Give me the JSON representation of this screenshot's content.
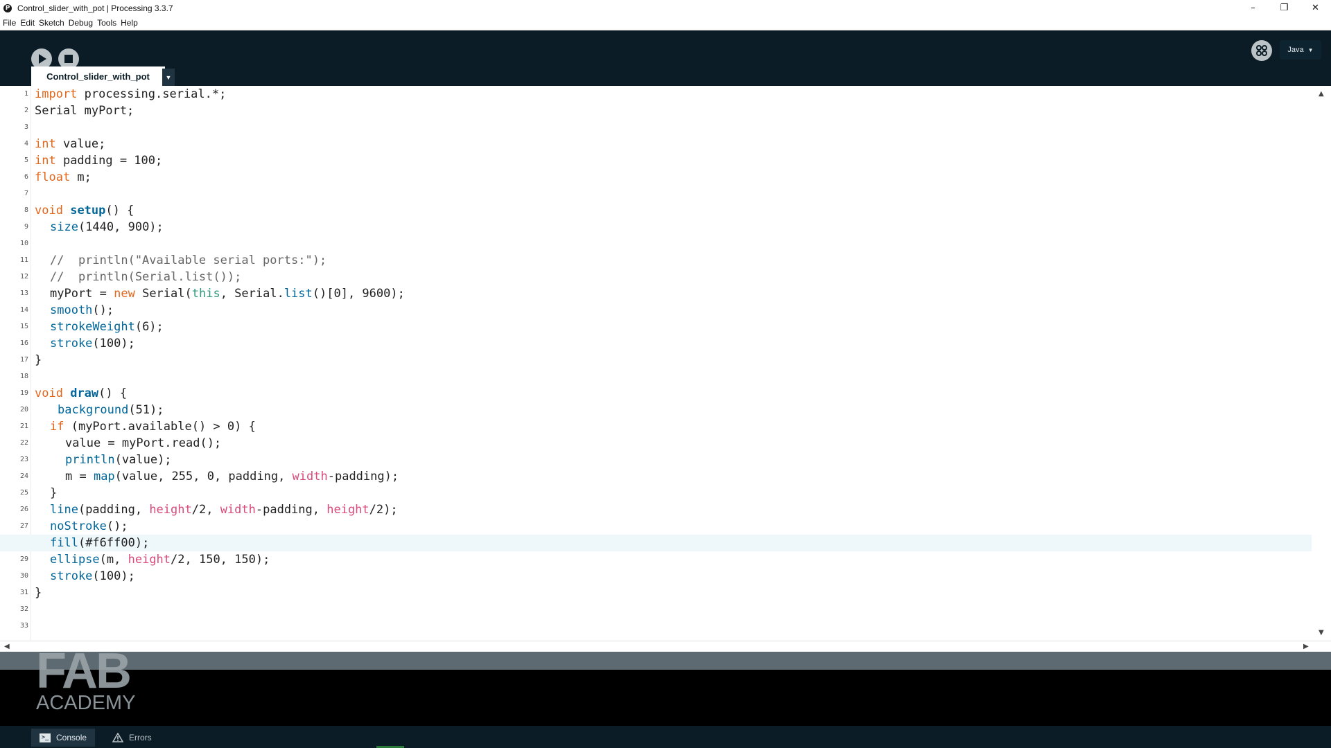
{
  "window": {
    "title": "Control_slider_with_pot | Processing 3.3.7",
    "icon": "processing-icon",
    "controls": [
      "–",
      "❐",
      "✕"
    ]
  },
  "menu": [
    "File",
    "Edit",
    "Sketch",
    "Debug",
    "Tools",
    "Help"
  ],
  "toolbar": {
    "run_icon": "play-icon",
    "stop_icon": "stop-icon",
    "debug_icon": "debugger-icon",
    "mode_label": "Java",
    "mode_caret": "▼"
  },
  "tab": {
    "name": "Control_slider_with_pot",
    "menu_caret": "▼"
  },
  "editor": {
    "current_line": 28,
    "line_numbers": [
      "1",
      "2",
      "3",
      "4",
      "5",
      "6",
      "7",
      "8",
      "9",
      "10",
      "11",
      "12",
      "13",
      "14",
      "15",
      "16",
      "17",
      "18",
      "19",
      "20",
      "21",
      "22",
      "23",
      "24",
      "25",
      "26",
      "27",
      "28",
      "29",
      "30",
      "31",
      "32",
      "33"
    ],
    "code": {
      "l1": {
        "kw": "import",
        "rest": " processing.serial.*;"
      },
      "l2": "Serial myPort;",
      "l4": {
        "kw": "int",
        "rest": " value;"
      },
      "l5": {
        "kw": "int",
        "rest": " padding = 100;"
      },
      "l6": {
        "kw": "float",
        "rest": " m;"
      },
      "l8": {
        "kw": "void",
        "fn": "setup",
        "rest": "() {"
      },
      "l9": {
        "fn": "size",
        "rest": "(1440, 900);"
      },
      "l11": "//  println(\"Available serial ports:\");",
      "l12": "//  println(Serial.list());",
      "l13": {
        "a": "myPort = ",
        "kw": "new",
        "b": " Serial(",
        "th": "this",
        "c": ", Serial.",
        "fn": "list",
        "d": "()[0], 9600);"
      },
      "l14": {
        "fn": "smooth",
        "rest": "();"
      },
      "l15": {
        "fn": "strokeWeight",
        "rest": "(6);"
      },
      "l16": {
        "fn": "stroke",
        "rest": "(100);"
      },
      "l17": "}",
      "l19": {
        "kw": "void",
        "fn": "draw",
        "rest": "() {"
      },
      "l20": {
        "fn": "background",
        "rest": "(51);"
      },
      "l21": {
        "kw": "if",
        "rest": " (myPort.available() > 0) {"
      },
      "l22": "value = myPort.read();",
      "l23": {
        "fn": "println",
        "rest": "(value);"
      },
      "l24": {
        "a": "m = ",
        "fn": "map",
        "b": "(value, 255, 0, padding, ",
        "var": "width",
        "c": "-padding);"
      },
      "l25": "}",
      "l26": {
        "fn": "line",
        "a": "(padding, ",
        "v1": "height",
        "b": "/2, ",
        "v2": "width",
        "c": "-padding, ",
        "v3": "height",
        "d": "/2);"
      },
      "l27": {
        "fn": "noStroke",
        "rest": "();"
      },
      "l28": {
        "fn": "fill",
        "rest": "(#f6ff00);"
      },
      "l29": {
        "fn": "ellipse",
        "a": "(m, ",
        "var": "height",
        "b": "/2, 150, 150);"
      },
      "l30": {
        "fn": "stroke",
        "rest": "(100);"
      },
      "l31": "}"
    }
  },
  "scroll": {
    "up": "▲",
    "down": "▼",
    "left": "◀",
    "right": "▶"
  },
  "logo": {
    "line1": "FAB",
    "line2": "ACADEMY"
  },
  "footer": {
    "console_label": "Console",
    "console_icon": "console-icon",
    "errors_label": "Errors",
    "errors_icon": "warning-icon"
  }
}
